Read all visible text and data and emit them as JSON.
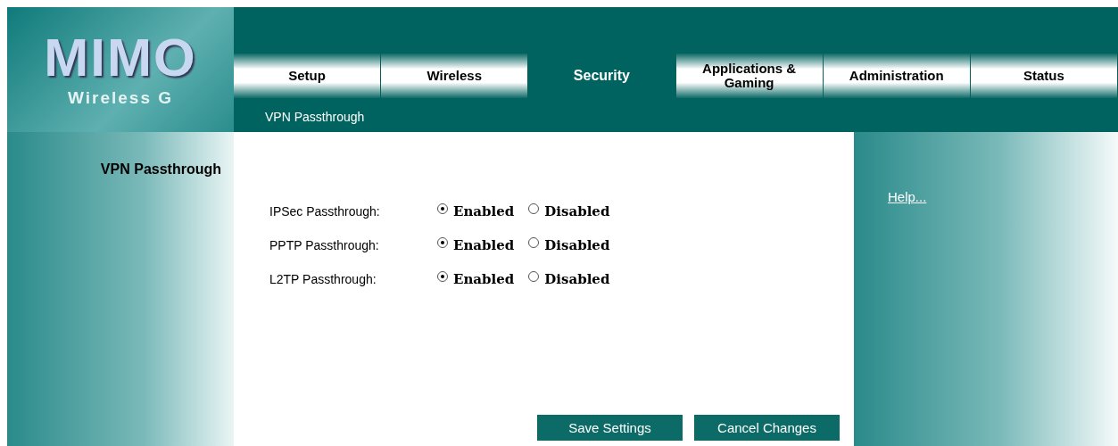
{
  "logo": {
    "title": "MIMO",
    "subtitle": "Wireless G"
  },
  "tabs": [
    {
      "label": "Setup",
      "selected": false
    },
    {
      "label": "Wireless",
      "selected": false
    },
    {
      "label": "Security",
      "selected": true
    },
    {
      "label": "Applications & Gaming",
      "selected": false
    },
    {
      "label": "Administration",
      "selected": false
    },
    {
      "label": "Status",
      "selected": false
    }
  ],
  "subnav": [
    {
      "label": "VPN Passthrough"
    }
  ],
  "section_title": "VPN Passthrough",
  "settings": [
    {
      "label": "IPSec Passthrough:",
      "options": [
        {
          "label": "Enabled",
          "selected": true
        },
        {
          "label": "Disabled",
          "selected": false
        }
      ]
    },
    {
      "label": "PPTP Passthrough:",
      "options": [
        {
          "label": "Enabled",
          "selected": true
        },
        {
          "label": "Disabled",
          "selected": false
        }
      ]
    },
    {
      "label": "L2TP Passthrough:",
      "options": [
        {
          "label": "Enabled",
          "selected": true
        },
        {
          "label": "Disabled",
          "selected": false
        }
      ]
    }
  ],
  "help_link": "Help...",
  "buttons": [
    "Save Settings",
    "Cancel Changes"
  ]
}
